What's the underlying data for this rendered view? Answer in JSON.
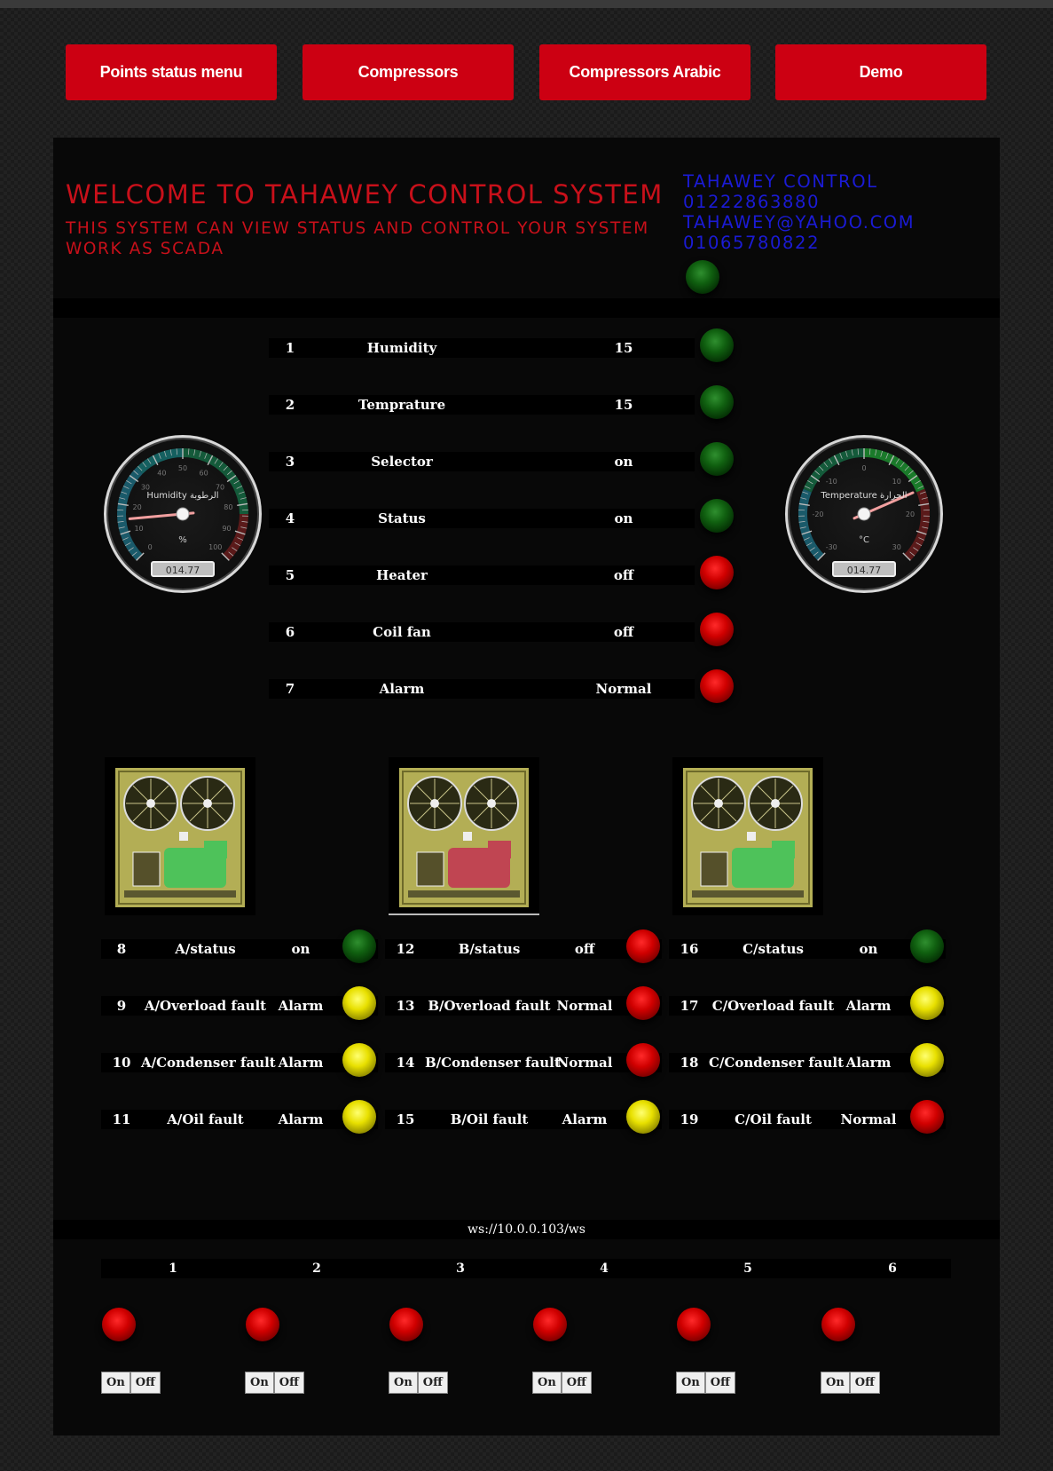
{
  "nav": {
    "buttons": [
      "Points status menu",
      "Compressors",
      "Compressors Arabic",
      "Demo"
    ]
  },
  "header": {
    "title": "WELCOME TO TAHAWEY CONTROL SYSTEM",
    "subtitle": "THIS SYSTEM CAN VIEW STATUS AND CONTROL YOUR SYSTEM WORK AS SCADA",
    "contact": [
      "TAHAWEY CONTROL",
      "01222863880",
      "TAHAWEY@YAHOO.COM",
      "01065780822"
    ],
    "connection_led": "green"
  },
  "gauges": {
    "humidity": {
      "label": "Humidity الرطوبة",
      "unit": "%",
      "value_display": "014.77",
      "value": 14.77,
      "min": 0,
      "max": 100,
      "ticks": [
        "0",
        "10",
        "20",
        "30",
        "40",
        "50",
        "60",
        "70",
        "80",
        "90",
        "100"
      ]
    },
    "temperature": {
      "label": "Temperature الحرارة",
      "unit": "°C",
      "value_display": "014.77",
      "value": 14.77,
      "min": -30,
      "max": 30,
      "ticks": [
        "-30",
        "-20",
        "-10",
        "0",
        "10",
        "20",
        "30"
      ]
    }
  },
  "points": [
    {
      "num": "1",
      "name": "Humidity",
      "value": "15",
      "led": "green"
    },
    {
      "num": "2",
      "name": "Temprature",
      "value": "15",
      "led": "green"
    },
    {
      "num": "3",
      "name": "Selector",
      "value": "on",
      "led": "green"
    },
    {
      "num": "4",
      "name": "Status",
      "value": "on",
      "led": "green"
    },
    {
      "num": "5",
      "name": "Heater",
      "value": "off",
      "led": "red"
    },
    {
      "num": "6",
      "name": "Coil fan",
      "value": "off",
      "led": "red"
    },
    {
      "num": "7",
      "name": "Alarm",
      "value": "Normal",
      "led": "red"
    }
  ],
  "compressors": [
    {
      "id": "A",
      "motor_color": "#4ec25a",
      "rows": [
        {
          "num": "8",
          "name": "A/status",
          "value": "on",
          "led": "green"
        },
        {
          "num": "9",
          "name": "A/Overload fault",
          "value": "Alarm",
          "led": "yellow"
        },
        {
          "num": "10",
          "name": "A/Condenser fault",
          "value": "Alarm",
          "led": "yellow"
        },
        {
          "num": "11",
          "name": "A/Oil fault",
          "value": "Alarm",
          "led": "yellow"
        }
      ]
    },
    {
      "id": "B",
      "motor_color": "#c04552",
      "rows": [
        {
          "num": "12",
          "name": "B/status",
          "value": "off",
          "led": "red"
        },
        {
          "num": "13",
          "name": "B/Overload fault",
          "value": "Normal",
          "led": "red"
        },
        {
          "num": "14",
          "name": "B/Condenser fault",
          "value": "Normal",
          "led": "red"
        },
        {
          "num": "15",
          "name": "B/Oil fault",
          "value": "Alarm",
          "led": "yellow"
        }
      ]
    },
    {
      "id": "C",
      "motor_color": "#4ec25a",
      "rows": [
        {
          "num": "16",
          "name": "C/status",
          "value": "on",
          "led": "green"
        },
        {
          "num": "17",
          "name": "C/Overload fault",
          "value": "Alarm",
          "led": "yellow"
        },
        {
          "num": "18",
          "name": "C/Condenser fault",
          "value": "Alarm",
          "led": "yellow"
        },
        {
          "num": "19",
          "name": "C/Oil fault",
          "value": "Normal",
          "led": "red"
        }
      ]
    }
  ],
  "websocket": "ws://10.0.0.103/ws",
  "outputs": [
    {
      "num": "1",
      "led": "red"
    },
    {
      "num": "2",
      "led": "red"
    },
    {
      "num": "3",
      "led": "red"
    },
    {
      "num": "4",
      "led": "red"
    },
    {
      "num": "5",
      "led": "red"
    },
    {
      "num": "6",
      "led": "red"
    }
  ],
  "onoff_labels": {
    "on": "On",
    "off": "Off"
  }
}
